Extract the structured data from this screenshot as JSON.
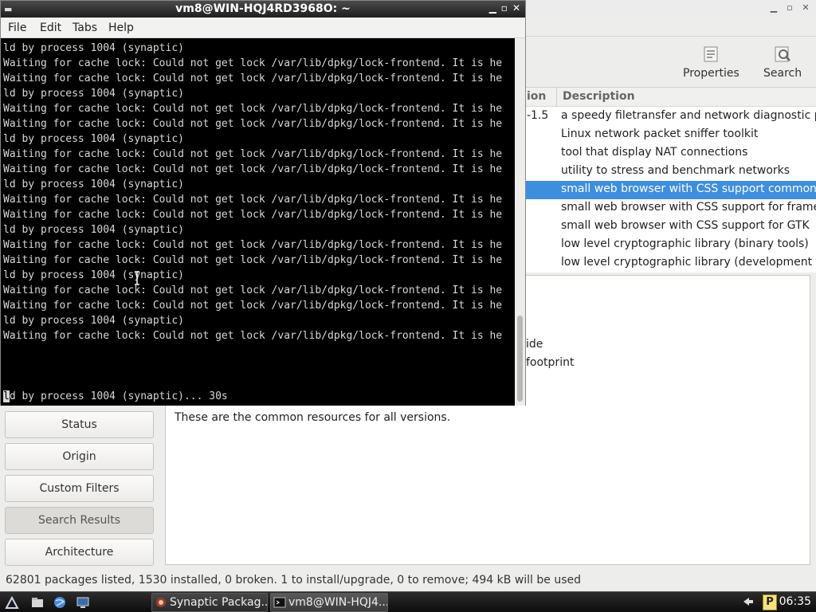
{
  "synaptic": {
    "toolbar": {
      "properties": "Properties",
      "search": "Search"
    },
    "table": {
      "version_header": "ion",
      "description_header": "Description",
      "rows": [
        {
          "version": "-1.5",
          "description": "a speedy filetransfer and network diagnostic prog",
          "selected": false
        },
        {
          "version": "",
          "description": "Linux network packet sniffer toolkit",
          "selected": false
        },
        {
          "version": "",
          "description": "tool that display NAT connections",
          "selected": false
        },
        {
          "version": "",
          "description": "utility to stress and benchmark networks",
          "selected": false
        },
        {
          "version": "",
          "description": "small web browser with CSS support common file",
          "selected": true
        },
        {
          "version": "",
          "description": "small web browser with CSS support for framebu",
          "selected": false
        },
        {
          "version": "",
          "description": "small web browser with CSS support for GTK",
          "selected": false
        },
        {
          "version": "",
          "description": "low level cryptographic library (binary tools)",
          "selected": false
        },
        {
          "version": "",
          "description": "low level cryptographic library (development files",
          "selected": false
        }
      ]
    },
    "details": {
      "line1": "ide",
      "line2": "footprint",
      "line3": "These are the common resources for all versions."
    },
    "filters": {
      "status": "Status",
      "origin": "Origin",
      "custom_filters": "Custom Filters",
      "search_results": "Search Results",
      "architecture": "Architecture"
    },
    "statusbar": "62801 packages listed, 1530 installed, 0 broken. 1 to install/upgrade, 0 to remove; 494 kB will be used"
  },
  "terminal": {
    "title": "vm8@WIN-HQJ4RD3968O: ~",
    "menu": {
      "file": "File",
      "edit": "Edit",
      "tabs": "Tabs",
      "help": "Help"
    },
    "lines": [
      "ld by process 1004 (synaptic)",
      "Waiting for cache lock: Could not get lock /var/lib/dpkg/lock-frontend. It is he",
      "Waiting for cache lock: Could not get lock /var/lib/dpkg/lock-frontend. It is he",
      "ld by process 1004 (synaptic)",
      "Waiting for cache lock: Could not get lock /var/lib/dpkg/lock-frontend. It is he",
      "Waiting for cache lock: Could not get lock /var/lib/dpkg/lock-frontend. It is he",
      "ld by process 1004 (synaptic)",
      "Waiting for cache lock: Could not get lock /var/lib/dpkg/lock-frontend. It is he",
      "Waiting for cache lock: Could not get lock /var/lib/dpkg/lock-frontend. It is he",
      "ld by process 1004 (synaptic)",
      "Waiting for cache lock: Could not get lock /var/lib/dpkg/lock-frontend. It is he",
      "Waiting for cache lock: Could not get lock /var/lib/dpkg/lock-frontend. It is he",
      "ld by process 1004 (synaptic)",
      "Waiting for cache lock: Could not get lock /var/lib/dpkg/lock-frontend. It is he",
      "Waiting for cache lock: Could not get lock /var/lib/dpkg/lock-frontend. It is he",
      "ld by process 1004 (synaptic)",
      "Waiting for cache lock: Could not get lock /var/lib/dpkg/lock-frontend. It is he",
      "Waiting for cache lock: Could not get lock /var/lib/dpkg/lock-frontend. It is he",
      "ld by process 1004 (synaptic)",
      "Waiting for cache lock: Could not get lock /var/lib/dpkg/lock-frontend. It is he"
    ],
    "last_line": {
      "cursor_char": "l",
      "rest": "d by process 1004 (synaptic)... 30s"
    }
  },
  "taskbar": {
    "tasks": [
      {
        "label": "Synaptic Packag...",
        "icon": "synaptic-icon"
      },
      {
        "label": "vm8@WIN-HQJ4...",
        "icon": "terminal-icon"
      }
    ],
    "tray_badge": "P",
    "clock": "06:35"
  }
}
